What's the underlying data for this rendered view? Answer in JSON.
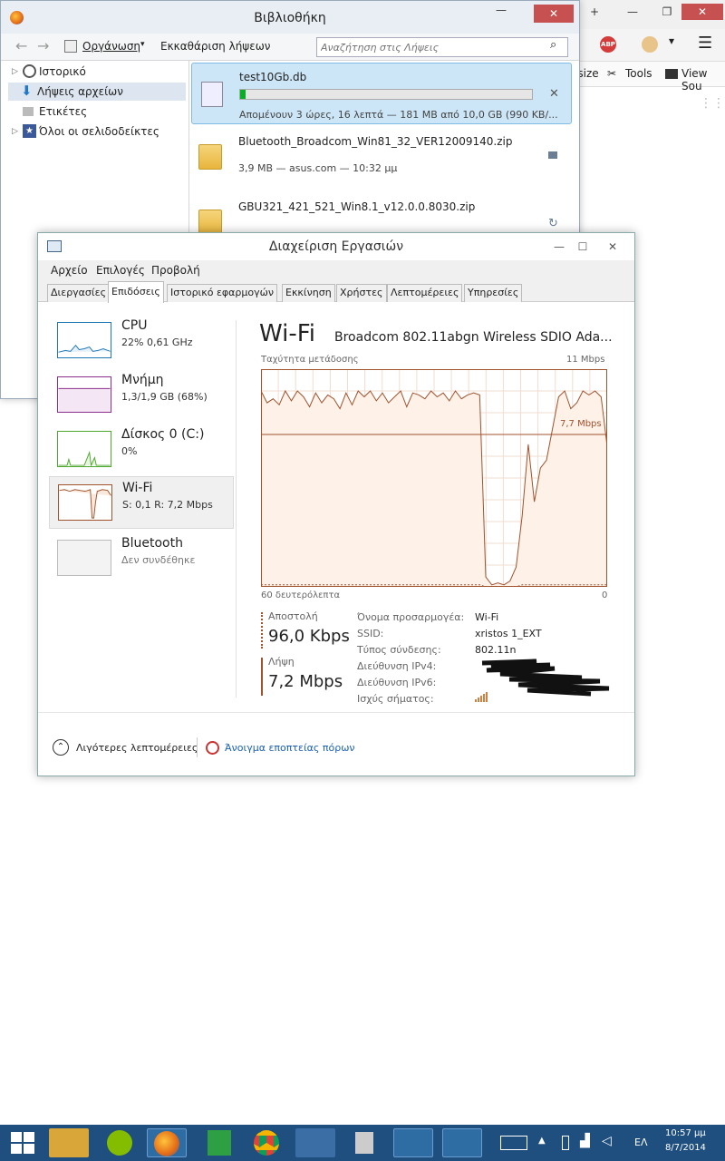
{
  "browser": {
    "bookmarks": [
      "esize",
      "Tools",
      "View Sou"
    ]
  },
  "library": {
    "title": "Βιβλιοθήκη",
    "organize_label": "Οργάνωση",
    "clear_downloads_label": "Εκκαθάριση λήψεων",
    "search_placeholder": "Αναζήτηση στις Λήψεις",
    "sidebar": [
      {
        "label": "Ιστορικό"
      },
      {
        "label": "Λήψεις αρχείων"
      },
      {
        "label": "Ετικέτες"
      },
      {
        "label": "Όλοι οι σελιδοδείκτες"
      }
    ],
    "downloads": [
      {
        "name": "test10Gb.db",
        "meta": "Απομένουν 3 ώρες, 16 λεπτά — 181 MB από 10,0 GB (990 KB/...",
        "progress": 0.018
      },
      {
        "name": "Bluetooth_Broadcom_Win81_32_VER12009140.zip",
        "meta": "3,9 MB — asus.com — 10:32 μμ"
      },
      {
        "name": "GBU321_421_521_Win8.1_v12.0.0.8030.zip",
        "meta": ""
      }
    ]
  },
  "taskmgr": {
    "title": "Διαχείριση Εργασιών",
    "menu": [
      "Αρχείο",
      "Επιλογές",
      "Προβολή"
    ],
    "tabs": [
      "Διεργασίες",
      "Επιδόσεις",
      "Ιστορικό εφαρμογών",
      "Εκκίνηση",
      "Χρήστες",
      "Λεπτομέρειες",
      "Υπηρεσίες"
    ],
    "resources": [
      {
        "name": "CPU",
        "value": "22% 0,61 GHz",
        "color": "#1f78b4"
      },
      {
        "name": "Μνήμη",
        "value": "1,3/1,9 GB (68%)",
        "color": "#8b2e8b"
      },
      {
        "name": "Δίσκος 0 (C:)",
        "value": "0%",
        "color": "#4ea72e"
      },
      {
        "name": "Wi-Fi",
        "value": "S: 0,1 R: 7,2 Mbps",
        "color": "#a0522d"
      },
      {
        "name": "Bluetooth",
        "value": "Δεν συνδέθηκε",
        "color": "#999999"
      }
    ],
    "detail": {
      "heading": "Wi-Fi",
      "adapter": "Broadcom 802.11abgn Wireless SDIO Ada...",
      "throughput_label": "Ταχύτητα μετάδοσης",
      "max_label": "11 Mbps",
      "current_label": "7,7 Mbps",
      "x_left": "60 δευτερόλεπτα",
      "x_right": "0",
      "send_label": "Αποστολή",
      "send_value": "96,0 Kbps",
      "recv_label": "Λήψη",
      "recv_value": "7,2 Mbps",
      "info": [
        {
          "k": "Όνομα προσαρμογέα:",
          "v": "Wi-Fi"
        },
        {
          "k": "SSID:",
          "v": "xristos 1_EXT"
        },
        {
          "k": "Τύπος σύνδεσης:",
          "v": "802.11n"
        },
        {
          "k": "Διεύθυνση IPv4:",
          "v": ""
        },
        {
          "k": "Διεύθυνση IPv6:",
          "v": ""
        },
        {
          "k": "Ισχύς σήματος:",
          "v": ""
        }
      ]
    },
    "fewer_details": "Λιγότερες λεπτομέρειες",
    "open_monitor": "Άνοιγμα εποπτείας πόρων"
  },
  "chart_data": {
    "type": "line",
    "xlabel": "60 δευτερόλεπτα",
    "ylabel": "Ταχύτητα μετάδοσης",
    "ylim": [
      0,
      11
    ],
    "series": [
      {
        "name": "Λήψη",
        "values": [
          9.9,
          9.3,
          9.5,
          9.2,
          9.9,
          9.4,
          9.9,
          9.6,
          9.1,
          9.8,
          9.3,
          9.7,
          9.5,
          9.0,
          9.8,
          9.2,
          9.9,
          9.6,
          9.9,
          9.4,
          9.8,
          9.3,
          9.6,
          9.9,
          9.1,
          9.8,
          9.7,
          9.5,
          9.9,
          9.6,
          9.8,
          9.4,
          9.9,
          9.5,
          9.7,
          9.8,
          9.7,
          0.5,
          0.1,
          0.2,
          0.1,
          0.3,
          1.0,
          3.6,
          7.2,
          4.3,
          6.0,
          6.4,
          8.0,
          9.6,
          9.9,
          9.0,
          9.3,
          9.9,
          9.7,
          9.9,
          9.6,
          7.1
        ]
      },
      {
        "name": "Αποστολή",
        "values": [
          0.1,
          0.1,
          0.1,
          0.1,
          0.1,
          0.1,
          0.1,
          0.1,
          0.1,
          0.1,
          0.1,
          0.1,
          0.1,
          0.1,
          0.1,
          0.1,
          0.1,
          0.1,
          0.1,
          0.1,
          0.1,
          0.1,
          0.1,
          0.1,
          0.1,
          0.1,
          0.1,
          0.1,
          0.1,
          0.1,
          0.1,
          0.1,
          0.1,
          0.1,
          0.1,
          0.1,
          0.1,
          0.0,
          0.0,
          0.0,
          0.0,
          0.0,
          0.0,
          0.1,
          0.1,
          0.1,
          0.1,
          0.1,
          0.1,
          0.1,
          0.1,
          0.1,
          0.1,
          0.1,
          0.1,
          0.1,
          0.1,
          0.1
        ]
      }
    ],
    "grid": true
  },
  "taskbar": {
    "time": "10:57 μμ",
    "date": "8/7/2014",
    "lang": "ΕΛ"
  }
}
